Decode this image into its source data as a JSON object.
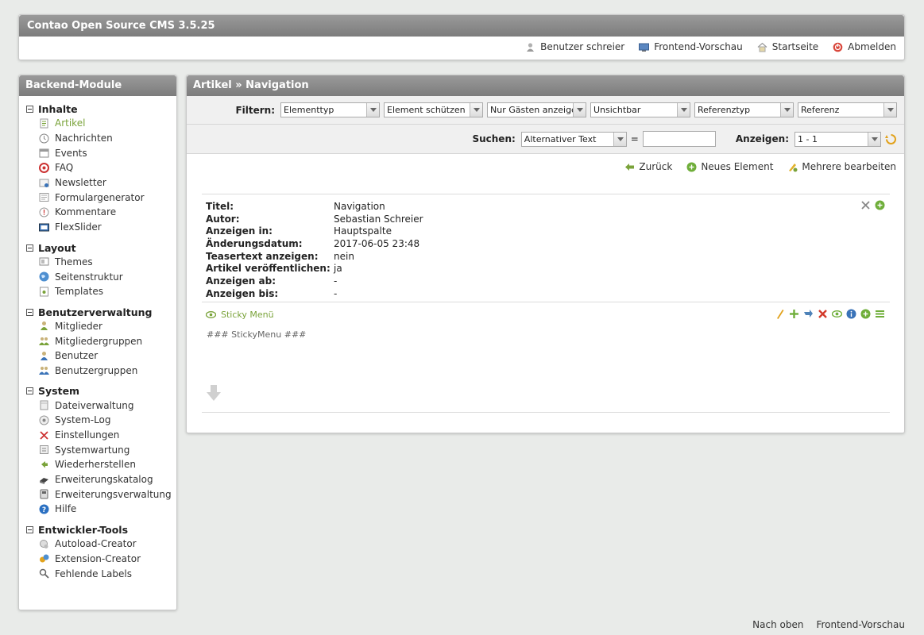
{
  "header": {
    "title": "Contao Open Source CMS 3.5.25",
    "user_label": "Benutzer schreier",
    "preview_label": "Frontend-Vorschau",
    "home_label": "Startseite",
    "logout_label": "Abmelden"
  },
  "sidebar": {
    "title": "Backend-Module",
    "groups": [
      {
        "label": "Inhalte",
        "items": [
          {
            "label": "Artikel",
            "icon": "article-icon",
            "active": true
          },
          {
            "label": "Nachrichten",
            "icon": "news-icon"
          },
          {
            "label": "Events",
            "icon": "calendar-icon"
          },
          {
            "label": "FAQ",
            "icon": "faq-icon"
          },
          {
            "label": "Newsletter",
            "icon": "newsletter-icon"
          },
          {
            "label": "Formulargenerator",
            "icon": "form-icon"
          },
          {
            "label": "Kommentare",
            "icon": "comments-icon"
          },
          {
            "label": "FlexSlider",
            "icon": "slider-icon"
          }
        ]
      },
      {
        "label": "Layout",
        "items": [
          {
            "label": "Themes",
            "icon": "themes-icon"
          },
          {
            "label": "Seitenstruktur",
            "icon": "globe-icon"
          },
          {
            "label": "Templates",
            "icon": "templates-icon"
          }
        ]
      },
      {
        "label": "Benutzerverwaltung",
        "items": [
          {
            "label": "Mitglieder",
            "icon": "member-icon"
          },
          {
            "label": "Mitgliedergruppen",
            "icon": "member-group-icon"
          },
          {
            "label": "Benutzer",
            "icon": "user-icon"
          },
          {
            "label": "Benutzergruppen",
            "icon": "user-group-icon"
          }
        ]
      },
      {
        "label": "System",
        "items": [
          {
            "label": "Dateiverwaltung",
            "icon": "files-icon"
          },
          {
            "label": "System-Log",
            "icon": "log-icon"
          },
          {
            "label": "Einstellungen",
            "icon": "settings-icon"
          },
          {
            "label": "Systemwartung",
            "icon": "maintenance-icon"
          },
          {
            "label": "Wiederherstellen",
            "icon": "undo-icon"
          },
          {
            "label": "Erweiterungskatalog",
            "icon": "catalog-icon"
          },
          {
            "label": "Erweiterungsverwaltung",
            "icon": "extension-icon"
          },
          {
            "label": "Hilfe",
            "icon": "help-icon"
          }
        ]
      },
      {
        "label": "Entwickler-Tools",
        "items": [
          {
            "label": "Autoload-Creator",
            "icon": "autoload-icon"
          },
          {
            "label": "Extension-Creator",
            "icon": "extension-creator-icon"
          },
          {
            "label": "Fehlende Labels",
            "icon": "search-icon"
          }
        ]
      }
    ]
  },
  "main": {
    "title": "Artikel » Navigation",
    "filter_label": "Filtern:",
    "filters": [
      "Elementtyp",
      "Element schützen",
      "Nur Gästen anzeigen",
      "Unsichtbar",
      "Referenztyp",
      "Referenz"
    ],
    "search_label": "Suchen:",
    "search_field": "Alternativer Text",
    "equals": "=",
    "search_value": "",
    "show_label": "Anzeigen:",
    "show_value": "1 - 1",
    "actions": {
      "back": "Zurück",
      "new": "Neues Element",
      "edit_multiple": "Mehrere bearbeiten"
    },
    "article_info": [
      {
        "key": "Titel:",
        "value": "Navigation"
      },
      {
        "key": "Autor:",
        "value": "Sebastian Schreier"
      },
      {
        "key": "Anzeigen in:",
        "value": "Hauptspalte"
      },
      {
        "key": "Änderungsdatum:",
        "value": "2017-06-05 23:48"
      },
      {
        "key": "Teasertext anzeigen:",
        "value": "nein"
      },
      {
        "key": "Artikel veröffentlichen:",
        "value": "ja"
      },
      {
        "key": "Anzeigen ab:",
        "value": "-"
      },
      {
        "key": "Anzeigen bis:",
        "value": "-"
      }
    ],
    "content_element": {
      "type_label": "Sticky Menü",
      "body": "### StickyMenu ###"
    }
  },
  "footer": {
    "top": "Nach oben",
    "preview": "Frontend-Vorschau"
  },
  "colors": {
    "accent_green": "#7aa33a",
    "header_gray": "#8a8a8a",
    "background": "#e9ebe9"
  }
}
